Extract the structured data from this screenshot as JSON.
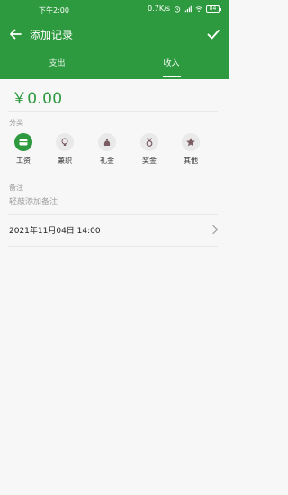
{
  "status_bar": {
    "time": "下午2:00",
    "network_speed": "0.7K/s",
    "battery": "84"
  },
  "header": {
    "title": "添加记录",
    "back_icon": "back-arrow-icon",
    "confirm_icon": "check-icon"
  },
  "tabs": [
    {
      "label": "支出",
      "active": false
    },
    {
      "label": "收入",
      "active": true
    }
  ],
  "amount": "￥0.00",
  "category": {
    "label": "分类",
    "items": [
      {
        "label": "工资",
        "icon": "wallet-icon",
        "selected": true
      },
      {
        "label": "兼职",
        "icon": "lightbulb-icon",
        "selected": false
      },
      {
        "label": "礼金",
        "icon": "money-bag-icon",
        "selected": false
      },
      {
        "label": "奖金",
        "icon": "medal-icon",
        "selected": false
      },
      {
        "label": "其他",
        "icon": "star-icon",
        "selected": false
      }
    ]
  },
  "note": {
    "label": "备注",
    "placeholder": "轻敲添加备注",
    "value": ""
  },
  "date": "2021年11月04日 14:00",
  "colors": {
    "accent": "#2e9a3f",
    "icon_inactive": "#7b5c63",
    "background": "#f7f7f7"
  }
}
